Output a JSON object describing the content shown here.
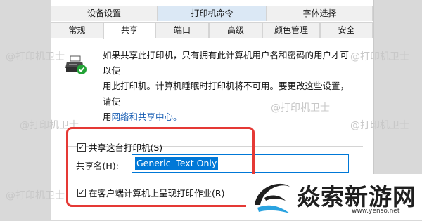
{
  "tabs_row1": [
    {
      "label": "设备设置"
    },
    {
      "label": "打印机命令"
    },
    {
      "label": "字体选择"
    }
  ],
  "tabs_row2": [
    {
      "label": "常规"
    },
    {
      "label": "共享"
    },
    {
      "label": "端口"
    },
    {
      "label": "高级"
    },
    {
      "label": "颜色管理"
    },
    {
      "label": "安全"
    }
  ],
  "description": {
    "line1": "如果共享此打印机，只有拥有此计算机用户名和密码的用户才可以使",
    "line2": "用此打印机。计算机睡眠时打印机将不可用。要更改这些设置，请使",
    "line3_prefix": "用",
    "link": "网络和共享中心。"
  },
  "share_checkbox": {
    "label": "共享这台打印机(S)",
    "checked": true,
    "mark": "✓"
  },
  "share_name": {
    "label": "共享名(H):",
    "value": "Generic  Text Only"
  },
  "render_checkbox": {
    "label": "在客户端计算机上呈现打印作业(R)",
    "checked": true,
    "mark": "✓"
  },
  "watermark": "@打印机卫士",
  "logo": {
    "text": "焱索新游网",
    "url": "www.yenso.net"
  },
  "colors": {
    "accent": "#0078d7",
    "highlight": "#e53935",
    "link": "#1a5fb4"
  }
}
